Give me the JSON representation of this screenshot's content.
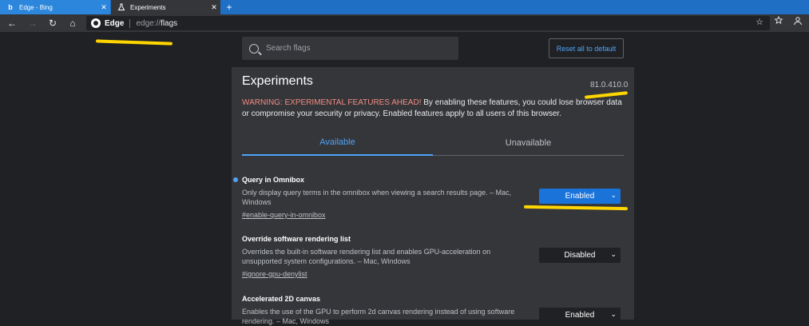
{
  "tabs": [
    {
      "title": "Edge - Bing",
      "icon": "bing-logo-icon",
      "close": "✕"
    },
    {
      "title": "Experiments",
      "icon": "flask-icon",
      "close": "✕"
    }
  ],
  "new_tab_label": "+",
  "toolbar": {
    "back": "←",
    "forward": "→",
    "refresh": "↻",
    "home": "⌂",
    "brand": "Edge",
    "url_scheme": "edge://",
    "url_path": "flags",
    "favorite": "☆"
  },
  "search": {
    "placeholder": "Search flags",
    "value": ""
  },
  "reset_label": "Reset all to default",
  "page": {
    "title": "Experiments",
    "version": "81.0.410.0",
    "warning_strong": "WARNING: EXPERIMENTAL FEATURES AHEAD!",
    "warning_rest": " By enabling these features, you could lose browser data or compromise your security or privacy. Enabled features apply to all users of this browser."
  },
  "flag_tabs": {
    "available": "Available",
    "unavailable": "Unavailable"
  },
  "flags": [
    {
      "name": "Query in Omnibox",
      "desc": "Only display query terms in the omnibox when viewing a search results page. – Mac, Windows",
      "link": "#enable-query-in-omnibox",
      "value": "Enabled"
    },
    {
      "name": "Override software rendering list",
      "desc": "Overrides the built-in software rendering list and enables GPU-acceleration on unsupported system configurations. – Mac, Windows",
      "link": "#ignore-gpu-denylist",
      "value": "Disabled"
    },
    {
      "name": "Accelerated 2D canvas",
      "desc": "Enables the use of the GPU to perform 2d canvas rendering instead of using software rendering. – Mac, Windows",
      "link": "",
      "value": "Enabled"
    }
  ],
  "colors": {
    "accent": "#1a73d9",
    "highlight": "#ffd600",
    "warning": "#f28b82"
  }
}
